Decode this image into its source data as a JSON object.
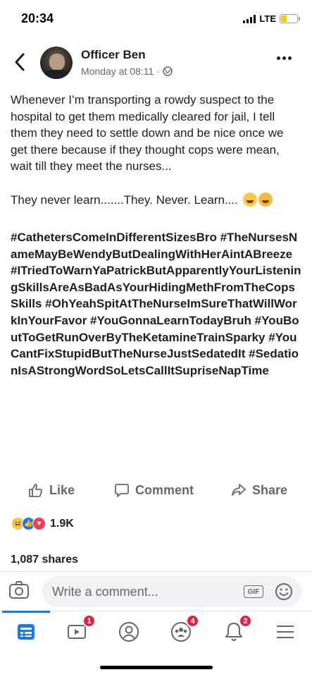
{
  "status_bar": {
    "time": "20:34",
    "network": "LTE",
    "battery_level": 0.35,
    "charging": true
  },
  "header": {
    "author": "Officer Ben",
    "timestamp": "Monday at 08:11 ·",
    "privacy_icon": "globe-icon",
    "back_icon": "chevron-left-icon",
    "more_icon": "ellipsis-icon"
  },
  "post": {
    "paragraph1": "Whenever I’m transporting a rowdy suspect to the hospital to get them medically cleared for jail, I tell them they need to settle down and be nice once we get there because if they thought cops were mean, wait till they meet the nurses...",
    "paragraph2": "They never learn.......They. Never. Learn....",
    "emojis": [
      "laughing-emoji",
      "flushed-emoji"
    ],
    "hashtags": "#CathetersComeInDifferentSizesBro #TheNursesNameMayBeWendyButDealingWithHerAintABreeze #ITriedToWarnYaPatrickButApparentlyYourListeningSkillsAreAsBadAsYourHidingMethFromTheCopsSkills #OhYeahSpitAtTheNurseImSureThatWillWorkInYourFavor #YouGonnaLearnTodayBruh #YouBoutToGetRunOverByTheKetamineTrainSparky #YouCantFixStupidButTheNurseJustSedatedIt #SedationIsAStrongWordSoLetsCallItSupriseNapTime"
  },
  "actions": {
    "like": "Like",
    "comment": "Comment",
    "share": "Share"
  },
  "reactions": {
    "types": [
      "haha",
      "like",
      "love"
    ],
    "count": "1.9K"
  },
  "shares": "1,087 shares",
  "composer": {
    "placeholder": "Write a comment...",
    "gif_label": "GIF"
  },
  "tabbar": {
    "active": "news-feed",
    "badges": {
      "watch": "1",
      "groups": "4",
      "notifications": "2"
    }
  },
  "colors": {
    "accent": "#1877f2",
    "badge": "#e41e3f",
    "secondary_text": "#65676b"
  }
}
